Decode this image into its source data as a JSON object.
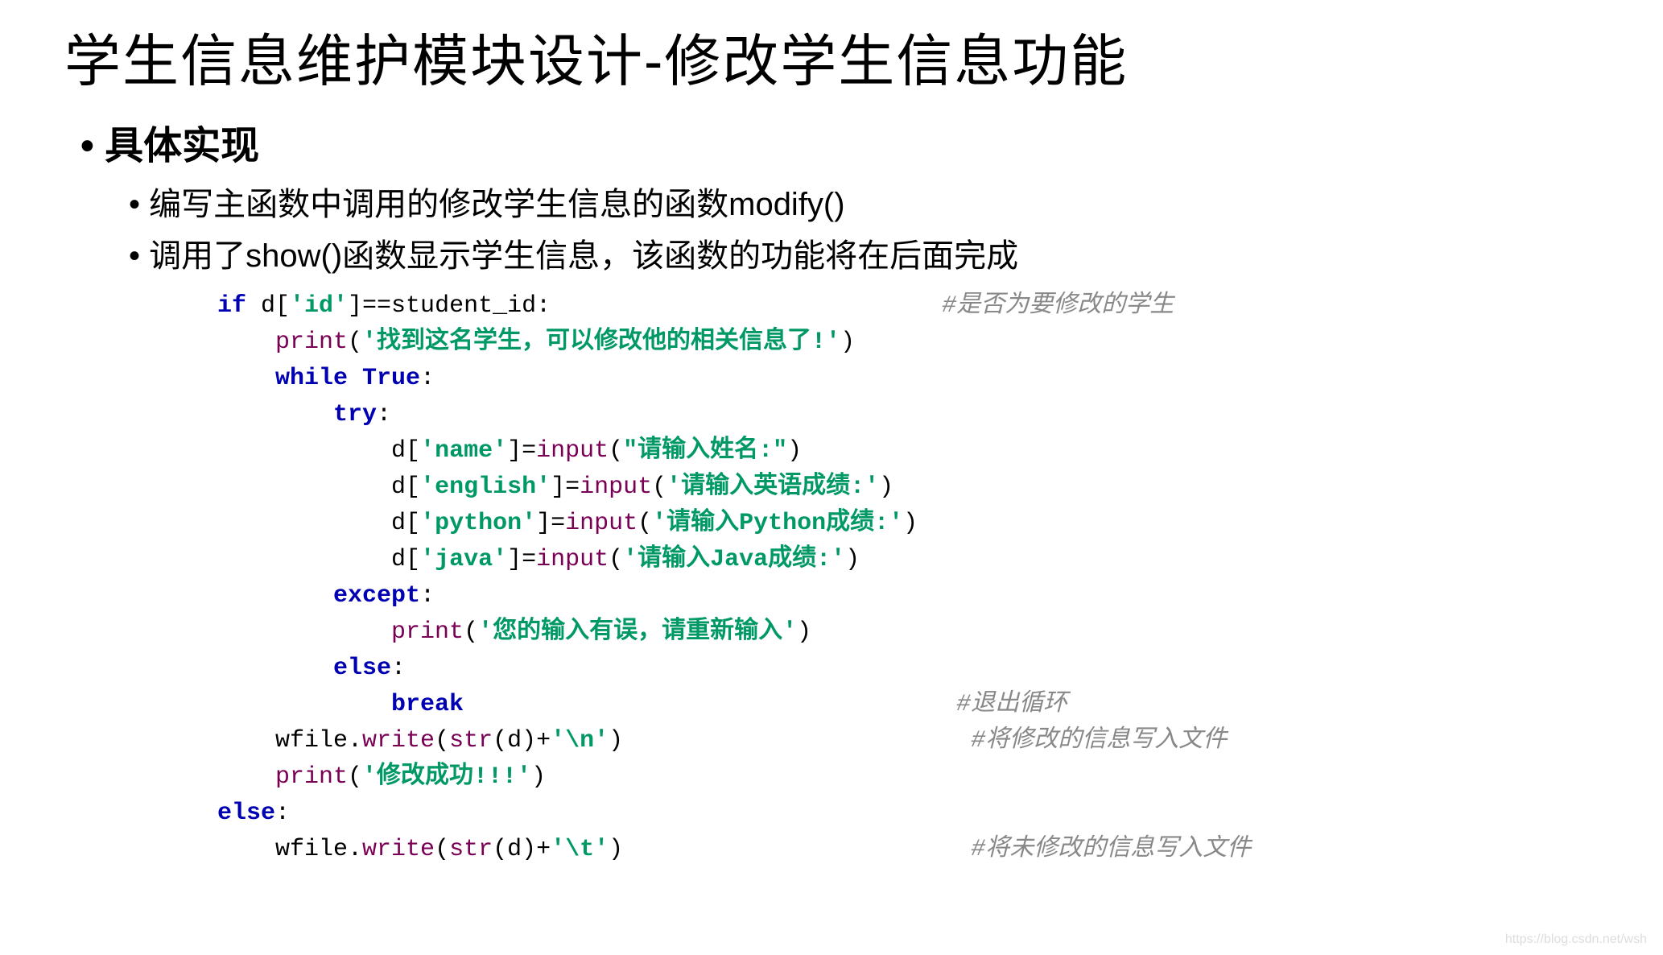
{
  "title": "学生信息维护模块设计-修改学生信息功能",
  "section_heading": "具体实现",
  "bullets": [
    "编写主函数中调用的修改学生信息的函数modify()",
    "调用了show()函数显示学生信息，该函数的功能将在后面完成"
  ],
  "code": {
    "l1_if": "if",
    "l1_rest_a": " d[",
    "l1_key_id": "'id'",
    "l1_rest_b": "]==student_id:",
    "l1_cmt": "#是否为要修改的学生",
    "l2_fn": "print",
    "l2_str": "'找到这名学生，可以修改他的相关信息了!'",
    "l3_while": "while",
    "l3_true": "True",
    "l4_try": "try",
    "l5_pre": "d[",
    "l5_key": "'name'",
    "l5_mid": "]=",
    "l5_fn": "input",
    "l5_str": "\"请输入姓名:\"",
    "l6_key": "'english'",
    "l6_str": "'请输入英语成绩:'",
    "l7_key": "'python'",
    "l7_str": "'请输入Python成绩:'",
    "l8_key": "'java'",
    "l8_str": "'请输入Java成绩:'",
    "l9_except": "except",
    "l10_fn": "print",
    "l10_str": "'您的输入有误，请重新输入'",
    "l11_else": "else",
    "l12_break": "break",
    "l12_cmt": "#退出循环",
    "l13_a": "wfile.",
    "l13_fn": "write",
    "l13_b": "(",
    "l13_str_fn": "str",
    "l13_c": "(d)+",
    "l13_nl": "'\\n'",
    "l13_d": ")",
    "l13_cmt": "#将修改的信息写入文件",
    "l14_fn": "print",
    "l14_str": "'修改成功!!!'",
    "l15_else": "else",
    "l16_a": "wfile.",
    "l16_fn": "write",
    "l16_b": "(",
    "l16_str_fn": "str",
    "l16_c": "(d)+",
    "l16_tab": "'\\t'",
    "l16_d": ")",
    "l16_cmt": "#将未修改的信息写入文件"
  },
  "watermark": "https://blog.csdn.net/wsh"
}
